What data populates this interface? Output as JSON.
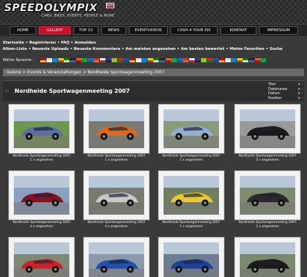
{
  "site": {
    "logo": "SPEEDOLYMPIX",
    "badge": "beta",
    "tagline": "CARS, BIKES, EVENTS, PEOPLE & MORE"
  },
  "nav": [
    {
      "label": "Home",
      "active": false
    },
    {
      "label": "Gallery",
      "active": true
    },
    {
      "label": "Top 10",
      "active": false
    },
    {
      "label": "News",
      "active": false
    },
    {
      "label": "Eventvideos",
      "active": false
    },
    {
      "label": "Cash 4 your Pix",
      "active": false
    },
    {
      "label": "Kontakt",
      "active": false
    },
    {
      "label": "Impressum",
      "active": false
    }
  ],
  "links": {
    "row1": [
      "Startseite",
      "Registrieren",
      "FAQ",
      "Anmelden"
    ],
    "row2": [
      "Alben-Liste",
      "Neueste Uploads",
      "Neueste Kommentare",
      "Am meisten angesehen",
      "Am besten bewertet",
      "Meine Favoriten",
      "Suche"
    ]
  },
  "language_label": "Wähle Sprache:",
  "breadcrumb": "Galerie > Events & Veranstaltungen > Nordheide Sportwagenmeeting 2007",
  "album_title": "Nordheide Sportwagenmeeting 2007",
  "sort": [
    {
      "label": "Titel",
      "arrows": "+ -"
    },
    {
      "label": "Dateiname",
      "arrows": "+ -"
    },
    {
      "label": "Datum",
      "arrows": "+ -"
    },
    {
      "label": "Position",
      "arrows": "+ -"
    }
  ],
  "thumbnails": [
    {
      "caption": "Nordheide Sportwagenmeeting 2007",
      "views": "1 x angesehen",
      "bg": "#6d9a4a",
      "car": "#5b6fa8"
    },
    {
      "caption": "Nordheide Sportwagenmeeting 2007",
      "views": "1 x angesehen",
      "bg": "#7a7a72",
      "car": "#e06a14"
    },
    {
      "caption": "Nordheide Sportwagenmeeting 2007",
      "views": "1 x angesehen",
      "bg": "#8a9a7a",
      "car": "#8eb0d6"
    },
    {
      "caption": "Nordheide Sportwagenmeeting 2007",
      "views": "5 x angesehen",
      "bg": "#9a9a9a",
      "car": "#1a1a1a"
    },
    {
      "caption": "Nordheide Sportwagenmeeting 2007",
      "views": "4 x angesehen",
      "bg": "#8aa0c0",
      "car": "#8a1020"
    },
    {
      "caption": "Nordheide Sportwagenmeeting 2007",
      "views": "4 x angesehen",
      "bg": "#7a7a70",
      "car": "#c8c8c8"
    },
    {
      "caption": "Nordheide Sportwagenmeeting 2007",
      "views": "1 x angesehen",
      "bg": "#6f7f5f",
      "car": "#e8c82a"
    },
    {
      "caption": "Nordheide Sportwagenmeeting 2007",
      "views": "1 x angesehen",
      "bg": "#7c8c6c",
      "car": "#2a2a2a"
    },
    {
      "caption": "",
      "views": "",
      "bg": "#7e8a74",
      "car": "#d0202a"
    },
    {
      "caption": "",
      "views": "",
      "bg": "#8a9aa8",
      "car": "#2050b0"
    },
    {
      "caption": "",
      "views": "",
      "bg": "#6e7e8e",
      "car": "#2040a0"
    },
    {
      "caption": "",
      "views": "",
      "bg": "#7a8a6a",
      "car": "#1c1c1c"
    }
  ],
  "colors": {
    "accent": "#c8102e",
    "background": "#3a3a3a",
    "breadcrumb": "#6a6a6a"
  }
}
